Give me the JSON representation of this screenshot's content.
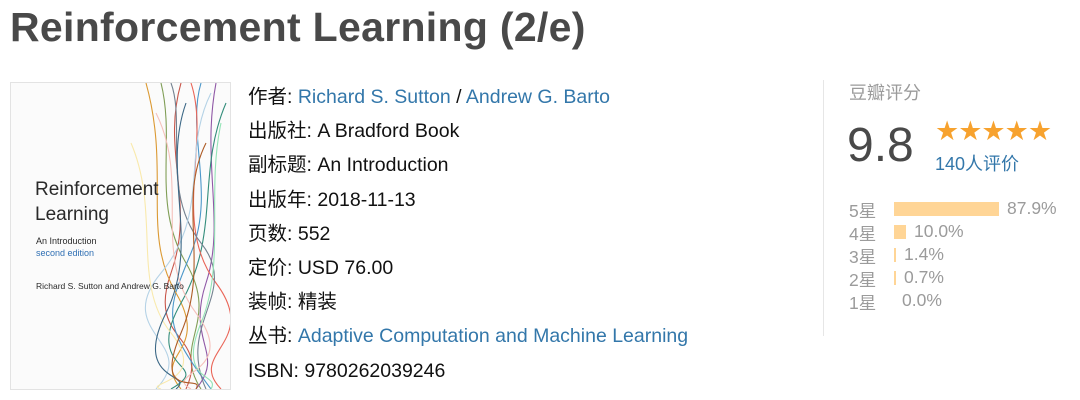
{
  "page_title": "Reinforcement Learning (2/e)",
  "cover": {
    "title_line1": "Reinforcement",
    "title_line2": "Learning",
    "subtitle": "An Introduction",
    "edition": "second edition",
    "authors": "Richard S. Sutton and Andrew G. Barto"
  },
  "info": {
    "author_label": "作者:",
    "author1": "Richard S. Sutton",
    "author_sep": " / ",
    "author2": "Andrew G. Barto",
    "publisher_label": "出版社:",
    "publisher": "A Bradford Book",
    "subtitle_label": "副标题:",
    "subtitle": "An Introduction",
    "pubdate_label": "出版年:",
    "pubdate": "2018-11-13",
    "pages_label": "页数:",
    "pages": "552",
    "price_label": "定价:",
    "price": "USD 76.00",
    "binding_label": "装帧:",
    "binding": "精装",
    "series_label": "丛书:",
    "series": "Adaptive Computation and Machine Learning",
    "isbn_label": "ISBN:",
    "isbn": "9780262039246"
  },
  "rating": {
    "label": "豆瓣评分",
    "score": "9.8",
    "stars": "★★★★★",
    "votes": "140人评价",
    "distribution": [
      {
        "label": "5星",
        "percent_text": "87.9%",
        "fraction": 0.879
      },
      {
        "label": "4星",
        "percent_text": "10.0%",
        "fraction": 0.1
      },
      {
        "label": "3星",
        "percent_text": "1.4%",
        "fraction": 0.014
      },
      {
        "label": "2星",
        "percent_text": "0.7%",
        "fraction": 0.007
      },
      {
        "label": "1星",
        "percent_text": "0.0%",
        "fraction": 0.0
      }
    ]
  },
  "colors": {
    "link": "#3377aa",
    "star": "#f7a22e",
    "bar": "#ffd596",
    "muted": "#9b9b9b"
  }
}
